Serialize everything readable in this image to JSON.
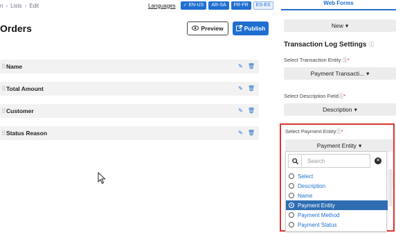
{
  "breadcrumb": {
    "first": "n",
    "second": "Lists",
    "current": "Edit"
  },
  "languages": {
    "label": "Languages",
    "items": [
      {
        "code": "EN-US",
        "checked": true
      },
      {
        "code": "AR-SA",
        "checked": false
      },
      {
        "code": "FR-FR",
        "checked": false
      },
      {
        "code": "ES-ES",
        "checked": false
      }
    ]
  },
  "page": {
    "title": "Orders",
    "preview_label": "Preview",
    "publish_label": "Publish"
  },
  "fields": [
    {
      "name": "Name"
    },
    {
      "name": "Total Amount"
    },
    {
      "name": "Customer"
    },
    {
      "name": "Status Reason"
    }
  ],
  "right_panel": {
    "tab_label": "Web Forms",
    "new_label": "New",
    "section_title": "Transaction Log Settings",
    "transaction_entity_label": "Select Transaction Entity",
    "transaction_entity_value": "Payment Transacti...",
    "description_field_label": "Select Description Field",
    "description_field_value": "Description",
    "payment_entity_label": "Select Payment Entity",
    "payment_entity_value": "Payment Entity"
  },
  "dropdown": {
    "search_placeholder": "Search",
    "options": [
      {
        "label": "Select",
        "active": false
      },
      {
        "label": "Description",
        "active": false
      },
      {
        "label": "Name",
        "active": false
      },
      {
        "label": "Payment Entity",
        "active": true
      },
      {
        "label": "Payment Method",
        "active": false
      },
      {
        "label": "Payment Status",
        "active": false
      }
    ]
  },
  "colors": {
    "accent": "#1f6fd1",
    "highlight_border": "#d9342b",
    "selected_option": "#2f6db3"
  }
}
